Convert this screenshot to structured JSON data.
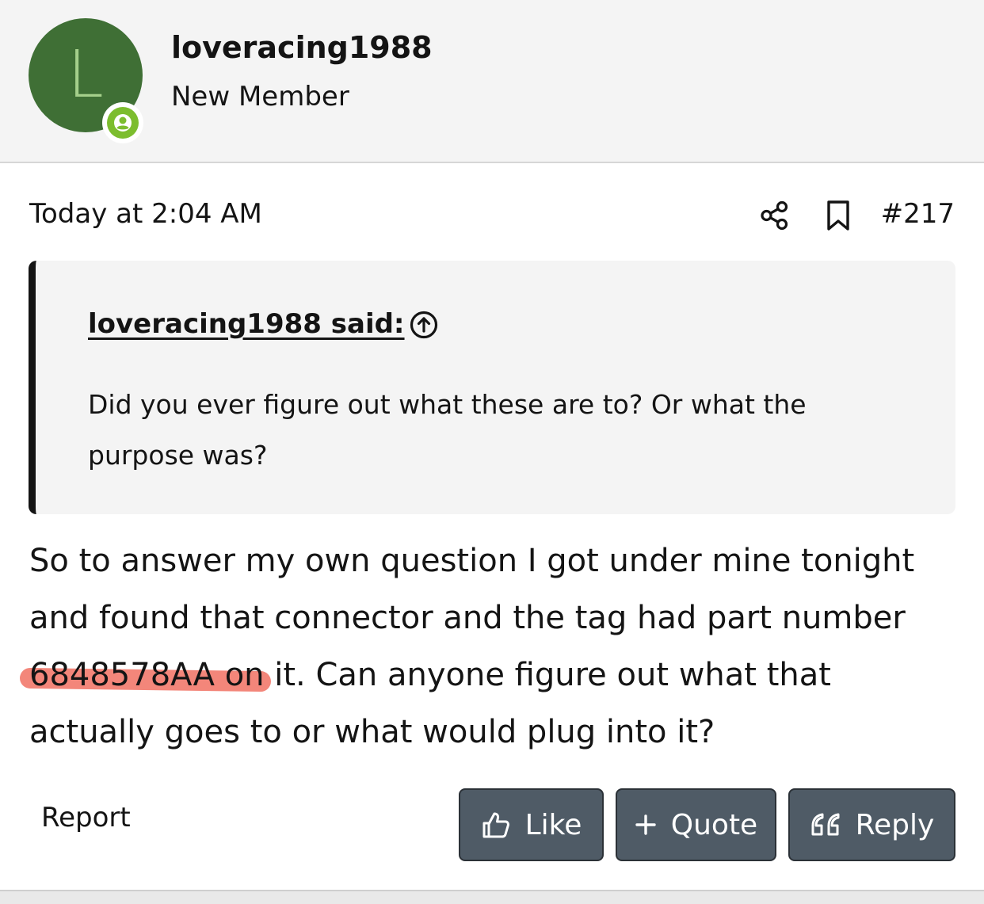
{
  "user": {
    "avatar_letter": "L",
    "avatar_color": "#3f6f35",
    "online_badge_icon": "user-icon",
    "online_color": "#7cbd2e",
    "username": "loveracing1988",
    "title": "New Member"
  },
  "post": {
    "date": "Today at 2:04 AM",
    "share_icon": "share-icon",
    "bookmark_icon": "bookmark-icon",
    "number": "#217"
  },
  "quote": {
    "author": "loveracing1988 said:",
    "jump_icon": "arrow-up-circle-icon",
    "text": "Did you ever figure out what these are to? Or what the purpose was?"
  },
  "message": {
    "before": "So to answer my own question I got under mine tonight and found that connector and the tag had part number ",
    "highlighted": "6848578AA on",
    "after": " it. Can anyone figure out what that actually goes to or what would plug into it?",
    "highlight_color": "#ee5846"
  },
  "actions": {
    "report": "Report",
    "like": "Like",
    "quote": "Quote",
    "reply": "Reply",
    "button_color": "#4f5b66"
  }
}
